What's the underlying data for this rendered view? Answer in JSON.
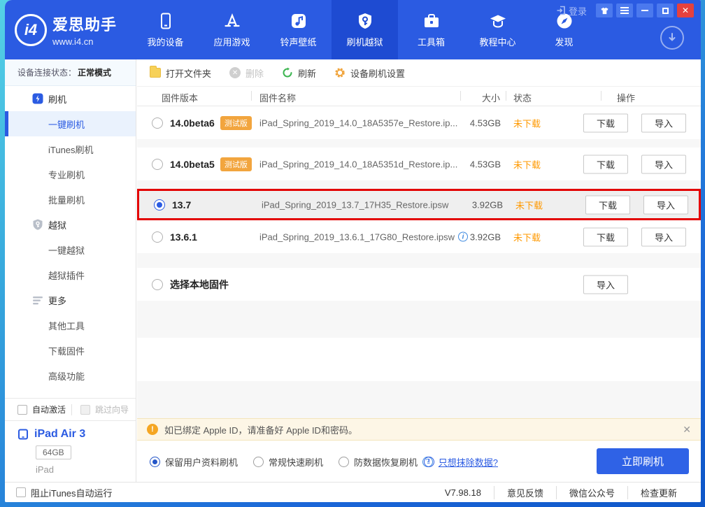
{
  "titlebar": {
    "logo": {
      "monogram": "i4",
      "name": "爱思助手",
      "url": "www.i4.cn"
    },
    "login_label": "登录",
    "nav": [
      {
        "label": "我的设备"
      },
      {
        "label": "应用游戏"
      },
      {
        "label": "铃声壁纸"
      },
      {
        "label": "刷机越狱"
      },
      {
        "label": "工具箱"
      },
      {
        "label": "教程中心"
      },
      {
        "label": "发现"
      }
    ],
    "icons": {
      "close": "✕",
      "delete": "✕"
    }
  },
  "colors": {
    "primary_blue": "#2b5be2",
    "nav_selected_blue": "#1e4bd2",
    "close_red": "#e5413e",
    "badge_orange": "#f2a53e",
    "status_orange": "#ff9900",
    "annotation_red": "#e30000",
    "notice_bg": "#fdf6e6"
  },
  "sidebar": {
    "connection": {
      "label": "设备连接状态：",
      "value": "正常模式"
    },
    "menu": [
      {
        "label": "刷机"
      },
      {
        "label": "一键刷机"
      },
      {
        "label": "iTunes刷机"
      },
      {
        "label": "专业刷机"
      },
      {
        "label": "批量刷机"
      },
      {
        "label": "越狱"
      },
      {
        "label": "一键越狱"
      },
      {
        "label": "越狱插件"
      },
      {
        "label": "更多"
      },
      {
        "label": "其他工具"
      },
      {
        "label": "下载固件"
      },
      {
        "label": "高级功能"
      }
    ],
    "toggles": {
      "auto_activate": "自动激活",
      "skip_wizard": "跳过向导"
    },
    "device": {
      "name": "iPad Air 3",
      "capacity": "64GB",
      "family": "iPad"
    }
  },
  "toolbar": {
    "open_folder": "打开文件夹",
    "delete": "删除",
    "refresh": "刷新",
    "device_settings": "设备刷机设置"
  },
  "table": {
    "columns": {
      "version": "固件版本",
      "name": "固件名称",
      "size": "大小",
      "status": "状态",
      "action": "操作"
    },
    "rows": [
      {
        "version": "14.0beta6",
        "badge": "测试版",
        "name": "iPad_Spring_2019_14.0_18A5357e_Restore.ip...",
        "size": "4.53GB",
        "status": "未下载",
        "download": "下载",
        "import": "导入"
      },
      {
        "version": "14.0beta5",
        "badge": "测试版",
        "name": "iPad_Spring_2019_14.0_18A5351d_Restore.ip...",
        "size": "4.53GB",
        "status": "未下载",
        "download": "下载",
        "import": "导入"
      },
      {
        "version": "13.7",
        "name": "iPad_Spring_2019_13.7_17H35_Restore.ipsw",
        "size": "3.92GB",
        "status": "未下载",
        "download": "下载",
        "import": "导入"
      },
      {
        "version": "13.6.1",
        "name": "iPad_Spring_2019_13.6.1_17G80_Restore.ipsw",
        "info_glyph": "i",
        "size": "3.92GB",
        "status": "未下载",
        "download": "下载",
        "import": "导入"
      },
      {
        "version": "选择本地固件",
        "import": "导入"
      }
    ]
  },
  "notice": {
    "warning_glyph": "!",
    "text": "如已绑定 Apple ID，请准备好 Apple ID和密码。",
    "close_glyph": "✕"
  },
  "flash_options": {
    "options": [
      {
        "label": "保留用户资料刷机"
      },
      {
        "label": "常规快速刷机"
      },
      {
        "label": "防数据恢复刷机"
      }
    ],
    "question_glyph": "?",
    "erase_excl_glyph": "!",
    "erase_link": "只想抹除数据?",
    "flash_button": "立即刷机"
  },
  "statusbar": {
    "block_itunes": "阻止iTunes自动运行",
    "version": "V7.98.18",
    "feedback": "意见反馈",
    "wechat": "微信公众号",
    "check_update": "检查更新"
  }
}
